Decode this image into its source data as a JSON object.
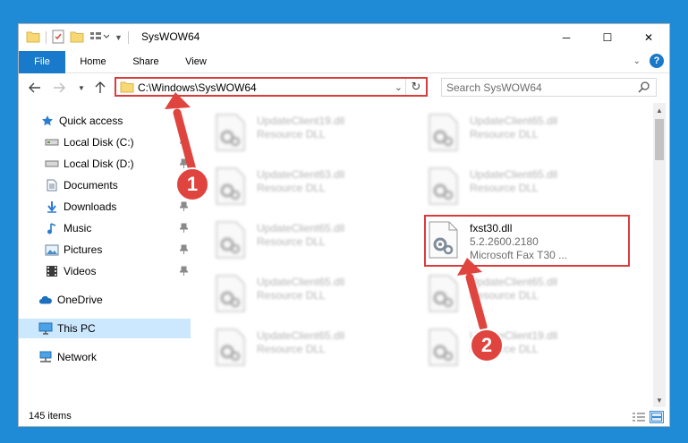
{
  "window": {
    "title": "SysWOW64",
    "controls": {
      "minimize": "─",
      "maximize": "☐",
      "close": "✕"
    }
  },
  "ribbon": {
    "tabs": [
      {
        "label": "File"
      },
      {
        "label": "Home"
      },
      {
        "label": "Share"
      },
      {
        "label": "View"
      }
    ],
    "help": "?"
  },
  "navigation": {
    "address": "C:\\Windows\\SysWOW64",
    "search_placeholder": "Search SysWOW64"
  },
  "sidebar": {
    "items": [
      {
        "label": "Quick access",
        "icon": "star-icon",
        "pinned": false
      },
      {
        "label": "Local Disk (C:)",
        "icon": "drive-icon",
        "pinned": true
      },
      {
        "label": "Local Disk (D:)",
        "icon": "drive-icon",
        "pinned": true
      },
      {
        "label": "Documents",
        "icon": "document-icon",
        "pinned": true
      },
      {
        "label": "Downloads",
        "icon": "download-icon",
        "pinned": true
      },
      {
        "label": "Music",
        "icon": "music-icon",
        "pinned": true
      },
      {
        "label": "Pictures",
        "icon": "pictures-icon",
        "pinned": true
      },
      {
        "label": "Videos",
        "icon": "video-icon",
        "pinned": true
      },
      {
        "label": "OneDrive",
        "icon": "cloud-icon",
        "pinned": false
      },
      {
        "label": "This PC",
        "icon": "computer-icon",
        "pinned": false,
        "selected": true
      },
      {
        "label": "Network",
        "icon": "network-icon",
        "pinned": false
      }
    ]
  },
  "files": [
    {
      "name": "UpdateClient19.dll",
      "type": "Resource DLL",
      "blurred": true
    },
    {
      "name": "UpdateClient65.dll",
      "type": "Resource DLL",
      "blurred": true
    },
    {
      "name": "UpdateClient63.dll",
      "type": "Resource DLL",
      "blurred": true
    },
    {
      "name": "UpdateClient65.dll",
      "type": "Resource DLL",
      "blurred": true
    },
    {
      "name": "UpdateClient65.dll",
      "type": "Resource DLL",
      "blurred": true
    },
    {
      "name": "fxst30.dll",
      "version": "5.2.2600.2180",
      "type": "Microsoft  Fax T30 ...",
      "blurred": false,
      "highlighted": true
    },
    {
      "name": "UpdateClient65.dll",
      "type": "Resource DLL",
      "blurred": true
    },
    {
      "name": "UpdateClient65.dll",
      "type": "Resource DLL",
      "blurred": true
    },
    {
      "name": "UpdateClient65.dll",
      "type": "Resource DLL",
      "blurred": true
    },
    {
      "name": "UpdateClient19.dll",
      "type": "Resource DLL",
      "blurred": true
    }
  ],
  "status": {
    "item_count": "145 items"
  },
  "annotations": [
    {
      "label": "1"
    },
    {
      "label": "2"
    }
  ],
  "colors": {
    "accent": "#1979ca",
    "highlight": "#d93c3c",
    "desktop": "#1f8ad6"
  }
}
